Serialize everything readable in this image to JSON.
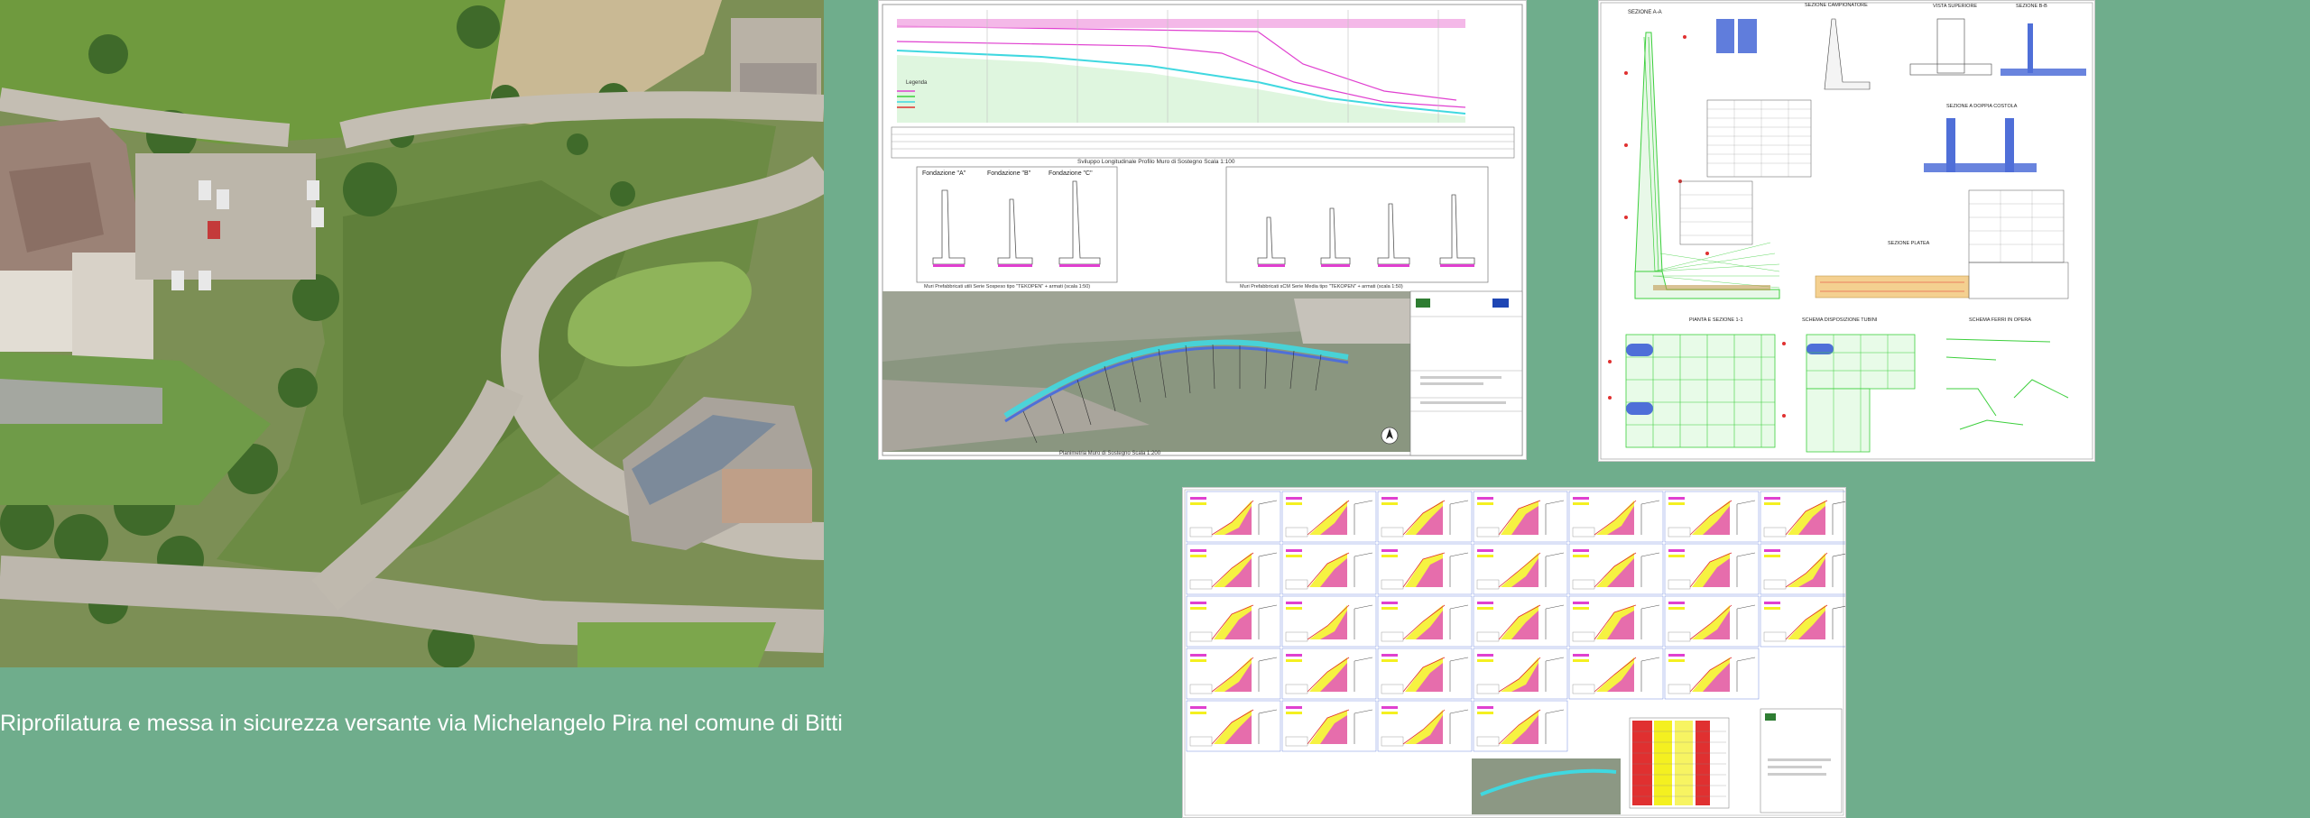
{
  "caption": "Riprofilatura e messa in sicurezza versante via Michelangelo Pira nel comune di Bitti",
  "profile_sheet": {
    "profile_title": "Sviluppo Longitudinale Profilo Muro di Sostegno  Scala 1:100",
    "foundation_a": "Fondazione \"A\"",
    "foundation_b": "Fondazione \"B\"",
    "foundation_c": "Fondazione \"C\"",
    "caption_left": "Muri Prefabbricati utili Serie Sospeso tipo \"TEKOPEN\" + armati  (scala 1:50)",
    "caption_right": "Muri Prefabbricati sCM Serie Media tipo \"TEKOPEN\" + armati  (scala 1:50)",
    "plan_caption": "Planimetria Muro di Sostegno  Scala 1:200",
    "legend_title": "Legenda"
  },
  "sections_sheet": {
    "sezione_aa": "SEZIONE A-A",
    "sezione_campionatore": "SEZIONE CAMPIONATORE",
    "vista_superiore": "VISTA SUPERIORE",
    "sezione_bb": "SEZIONE B-B",
    "sezione_doppia": "SEZIONE A DOPPIA COSTOLA",
    "sezione_platea": "SEZIONE PLATEA",
    "pianta_sezione": "PIANTA E SEZIONE 1-1",
    "schema_disposizione": "SCHEMA DISPOSIZIONE TUBINI",
    "schema_ferri": "SCHEMA FERRI IN OPERA"
  },
  "colors": {
    "background": "#6fad8c",
    "caption_text": "#ffffff",
    "drawing_magenta": "#e040d0",
    "drawing_green": "#3ccf3c",
    "drawing_cyan": "#40d8e0",
    "drawing_blue": "#4f6fd8",
    "drawing_red": "#e03030",
    "drawing_yellow": "#f4f020"
  },
  "icons": [
    "north-arrow-icon"
  ]
}
